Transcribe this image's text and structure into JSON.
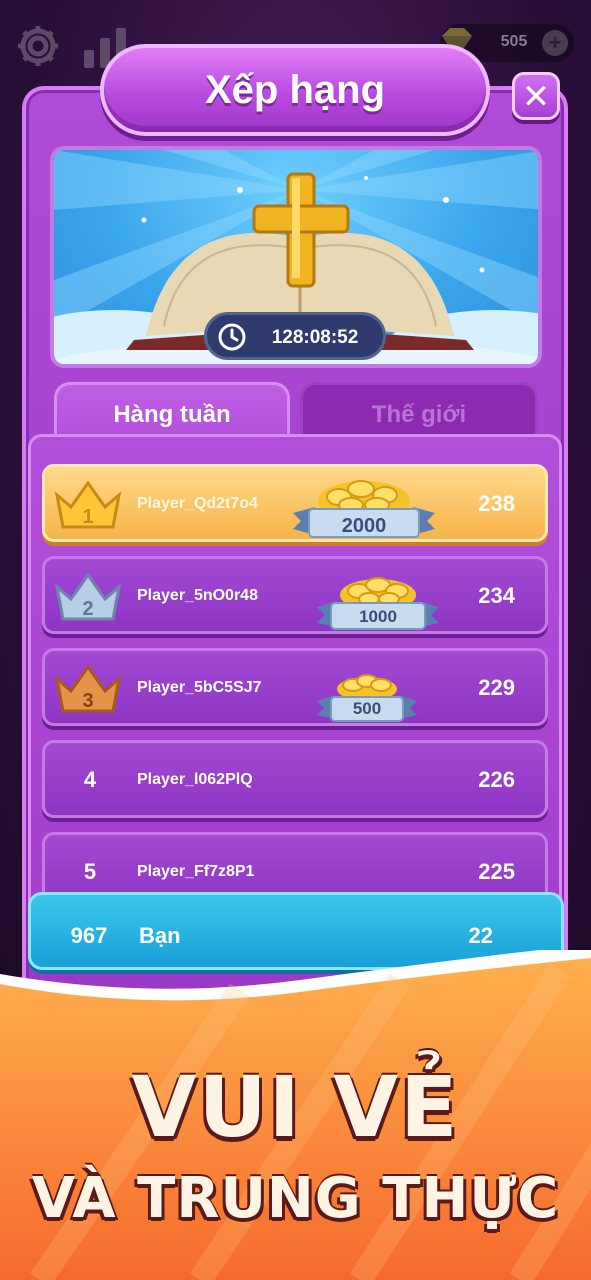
{
  "header": {
    "gem_count": "505",
    "plus_label": "+",
    "icons": [
      "gear-icon",
      "stats-icon",
      "gem-icon",
      "plus-icon"
    ]
  },
  "modal": {
    "title": "Xếp hạng",
    "close_label": "✕",
    "timer": "128:08:52",
    "tabs": [
      {
        "label": "Hàng tuần",
        "active": true
      },
      {
        "label": "Thế giới",
        "active": false
      }
    ]
  },
  "leaderboard": [
    {
      "rank": "1",
      "name": "Player_Qd2t7o4",
      "score": "238",
      "reward": "2000",
      "crown": "gold"
    },
    {
      "rank": "2",
      "name": "Player_5nO0r48",
      "score": "234",
      "reward": "1000",
      "crown": "silver"
    },
    {
      "rank": "3",
      "name": "Player_5bC5SJ7",
      "score": "229",
      "reward": "500",
      "crown": "bronze"
    },
    {
      "rank": "4",
      "name": "Player_l062PlQ",
      "score": "226"
    },
    {
      "rank": "5",
      "name": "Player_Ff7z8P1",
      "score": "225"
    }
  ],
  "me": {
    "rank": "967",
    "name": "Bạn",
    "score": "22"
  },
  "promo": {
    "headline": "VUI VẺ",
    "subline": "VÀ TRUNG THỰC"
  },
  "colors": {
    "panel": "#a642d2",
    "gold_row": "#f6b44a",
    "me_row": "#19a0d8",
    "promo_orange": "#f58a3a"
  }
}
